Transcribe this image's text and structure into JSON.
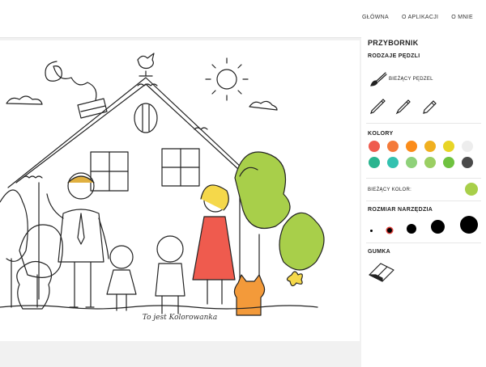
{
  "nav": {
    "items": [
      {
        "label": "GŁÓWNA"
      },
      {
        "label": "O APLIKACJI"
      },
      {
        "label": "O MNIE"
      }
    ]
  },
  "canvas": {
    "caption": "To jest Kolorowanka"
  },
  "toolbox": {
    "title": "PRZYBORNIK",
    "brushes_title": "RODZAJE PĘDZLI",
    "current_brush_label": "BIEŻĄCY PĘDZEL",
    "brush_icons": [
      "brush-icon",
      "pencil-icon",
      "pen-icon",
      "marker-icon"
    ],
    "colors_title": "KOLORY",
    "colors": [
      "#ef5b4e",
      "#f47a3a",
      "#fb8c1a",
      "#f0b020",
      "#e8d526",
      "#ededed",
      "#2ab48f",
      "#33c2b0",
      "#8fd17a",
      "#9bcf63",
      "#6fc23f",
      "#4a4a4a"
    ],
    "current_color_label": "BIEŻĄCY KOLOR:",
    "current_color": "#a8cf4a",
    "size_title": "ROZMIAR NARZĘDZIA",
    "sizes": [
      "1",
      "2",
      "3",
      "4",
      "5"
    ],
    "selected_size_color": "#e0403a",
    "eraser_title": "GUMKA",
    "eraser_icon": "eraser-icon"
  }
}
